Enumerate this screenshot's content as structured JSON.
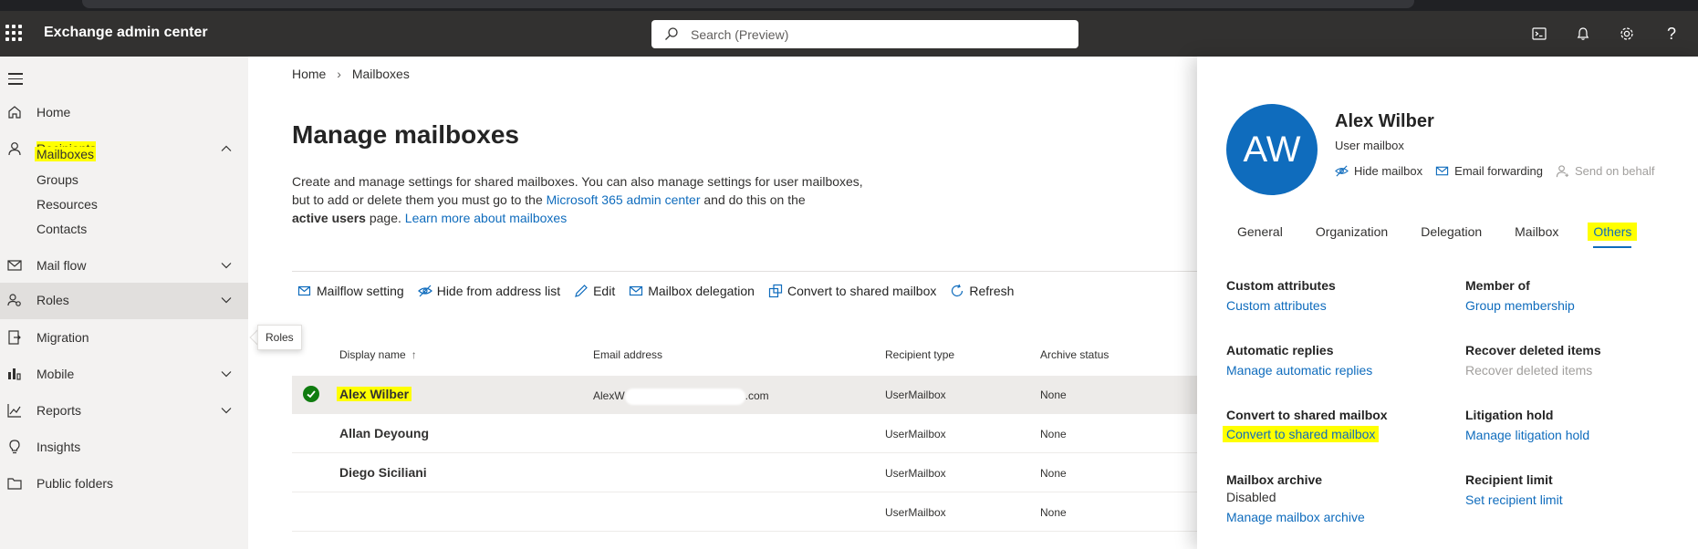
{
  "app": {
    "title": "Exchange admin center"
  },
  "search": {
    "placeholder": "Search (Preview)"
  },
  "topbar_icons": [
    "cloud-shell-icon",
    "bell-icon",
    "gear-icon",
    "help-icon"
  ],
  "nav": {
    "items": [
      {
        "id": "home",
        "label": "Home",
        "icon": "home-icon"
      },
      {
        "id": "recipients",
        "label": "Recipients",
        "icon": "person-icon",
        "expanded": true,
        "highlighted": true
      },
      {
        "id": "mail-flow",
        "label": "Mail flow",
        "icon": "mail-icon",
        "expanded": false
      },
      {
        "id": "roles",
        "label": "Roles",
        "icon": "roles-icon",
        "expanded": false,
        "hovered": true
      },
      {
        "id": "migration",
        "label": "Migration",
        "icon": "migration-icon"
      },
      {
        "id": "mobile",
        "label": "Mobile",
        "icon": "mobile-icon",
        "expanded": false
      },
      {
        "id": "reports",
        "label": "Reports",
        "icon": "chart-icon",
        "expanded": false
      },
      {
        "id": "insights",
        "label": "Insights",
        "icon": "lightbulb-icon"
      },
      {
        "id": "public-folders",
        "label": "Public folders",
        "icon": "folder-icon"
      }
    ],
    "recipients_sub": [
      "Mailboxes",
      "Groups",
      "Resources",
      "Contacts"
    ],
    "tooltip": "Roles"
  },
  "breadcrumb": {
    "home": "Home",
    "current": "Mailboxes"
  },
  "page": {
    "title": "Manage mailboxes",
    "desc_1": "Create and manage settings for shared mailboxes. You can also manage settings for user mailboxes,",
    "desc_2": "but to add or delete them you must go to the ",
    "desc_link_1": "Microsoft 365 admin center",
    "desc_3": " and do this on the",
    "desc_bold": "active users",
    "desc_4": " page. ",
    "desc_link_2": "Learn more about mailboxes"
  },
  "toolbar": {
    "mailflow": "Mailflow setting",
    "hide": "Hide from address list",
    "edit": "Edit",
    "delegation": "Mailbox delegation",
    "convert": "Convert to shared mailbox",
    "refresh": "Refresh"
  },
  "grid": {
    "headers": {
      "display_name": "Display name",
      "email": "Email address",
      "recipient_type": "Recipient type",
      "archive_status": "Archive status"
    },
    "rows": [
      {
        "name": "Alex Wilber",
        "email_start": "AlexW",
        "email_end": ".com",
        "type": "UserMailbox",
        "archive": "None",
        "selected": true
      },
      {
        "name": "Allan Deyoung",
        "email_start": "",
        "email_end": "",
        "type": "UserMailbox",
        "archive": "None"
      },
      {
        "name": "Diego Siciliani",
        "email_start": "",
        "email_end": "",
        "type": "UserMailbox",
        "archive": "None"
      },
      {
        "name": "",
        "email_start": "",
        "email_end": "",
        "type": "UserMailbox",
        "archive": "None"
      }
    ]
  },
  "panel": {
    "initials": "AW",
    "name": "Alex Wilber",
    "type": "User mailbox",
    "actions": {
      "hide": "Hide mailbox",
      "forwarding": "Email forwarding",
      "send_on_behalf": "Send on behalf"
    },
    "tabs": [
      "General",
      "Organization",
      "Delegation",
      "Mailbox",
      "Others"
    ],
    "active_tab": "Others",
    "sections": {
      "custom_attr_title": "Custom attributes",
      "custom_attr_link": "Custom attributes",
      "member_of_title": "Member of",
      "member_of_link": "Group membership",
      "auto_replies_title": "Automatic replies",
      "auto_replies_link": "Manage automatic replies",
      "recover_title": "Recover deleted items",
      "recover_link": "Recover deleted items",
      "convert_title": "Convert to shared mailbox",
      "convert_link": "Convert to shared mailbox",
      "litigation_title": "Litigation hold",
      "litigation_link": "Manage litigation hold",
      "archive_title": "Mailbox archive",
      "archive_status": "Disabled",
      "archive_link": "Manage mailbox archive",
      "recipient_limit_title": "Recipient limit",
      "recipient_limit_link": "Set recipient limit"
    }
  },
  "colors": {
    "accent": "#0f6cbd",
    "highlight": "#ffff00",
    "topbar": "#323130",
    "success": "#107c10"
  }
}
